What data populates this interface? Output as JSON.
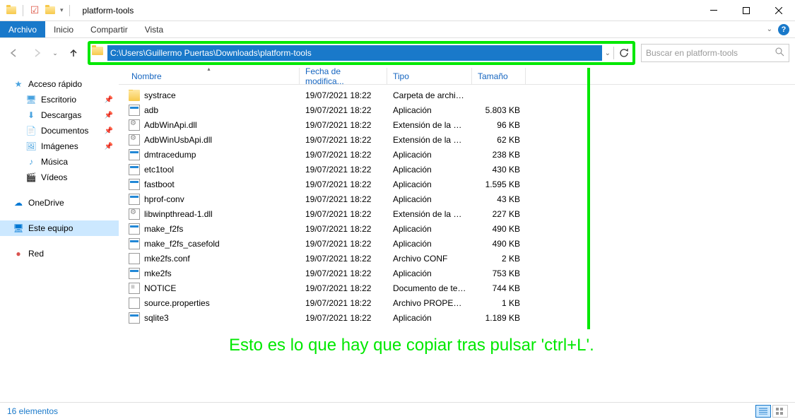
{
  "window": {
    "title": "platform-tools"
  },
  "ribbon": {
    "tabs": [
      "Archivo",
      "Inicio",
      "Compartir",
      "Vista"
    ],
    "active": 0
  },
  "nav": {
    "path": "C:\\Users\\Guillermo Puertas\\Downloads\\platform-tools",
    "search_placeholder": "Buscar en platform-tools"
  },
  "sidebar": {
    "quick": {
      "label": "Acceso rápido",
      "items": [
        {
          "label": "Escritorio",
          "pinned": true,
          "icon": "desktop"
        },
        {
          "label": "Descargas",
          "pinned": true,
          "icon": "downloads"
        },
        {
          "label": "Documentos",
          "pinned": true,
          "icon": "documents"
        },
        {
          "label": "Imágenes",
          "pinned": true,
          "icon": "images"
        },
        {
          "label": "Música",
          "pinned": false,
          "icon": "music"
        },
        {
          "label": "Vídeos",
          "pinned": false,
          "icon": "videos"
        }
      ]
    },
    "onedrive": {
      "label": "OneDrive"
    },
    "thispc": {
      "label": "Este equipo"
    },
    "network": {
      "label": "Red"
    }
  },
  "columns": {
    "name": "Nombre",
    "date": "Fecha de modifica...",
    "type": "Tipo",
    "size": "Tamaño"
  },
  "files": [
    {
      "name": "systrace",
      "date": "19/07/2021 18:22",
      "type": "Carpeta de archivos",
      "size": "",
      "icon": "folder"
    },
    {
      "name": "adb",
      "date": "19/07/2021 18:22",
      "type": "Aplicación",
      "size": "5.803 KB",
      "icon": "exe"
    },
    {
      "name": "AdbWinApi.dll",
      "date": "19/07/2021 18:22",
      "type": "Extensión de la apl...",
      "size": "96 KB",
      "icon": "dll"
    },
    {
      "name": "AdbWinUsbApi.dll",
      "date": "19/07/2021 18:22",
      "type": "Extensión de la apl...",
      "size": "62 KB",
      "icon": "dll"
    },
    {
      "name": "dmtracedump",
      "date": "19/07/2021 18:22",
      "type": "Aplicación",
      "size": "238 KB",
      "icon": "exe"
    },
    {
      "name": "etc1tool",
      "date": "19/07/2021 18:22",
      "type": "Aplicación",
      "size": "430 KB",
      "icon": "exe"
    },
    {
      "name": "fastboot",
      "date": "19/07/2021 18:22",
      "type": "Aplicación",
      "size": "1.595 KB",
      "icon": "exe"
    },
    {
      "name": "hprof-conv",
      "date": "19/07/2021 18:22",
      "type": "Aplicación",
      "size": "43 KB",
      "icon": "exe"
    },
    {
      "name": "libwinpthread-1.dll",
      "date": "19/07/2021 18:22",
      "type": "Extensión de la apl...",
      "size": "227 KB",
      "icon": "dll"
    },
    {
      "name": "make_f2fs",
      "date": "19/07/2021 18:22",
      "type": "Aplicación",
      "size": "490 KB",
      "icon": "exe"
    },
    {
      "name": "make_f2fs_casefold",
      "date": "19/07/2021 18:22",
      "type": "Aplicación",
      "size": "490 KB",
      "icon": "exe"
    },
    {
      "name": "mke2fs.conf",
      "date": "19/07/2021 18:22",
      "type": "Archivo CONF",
      "size": "2 KB",
      "icon": "blank"
    },
    {
      "name": "mke2fs",
      "date": "19/07/2021 18:22",
      "type": "Aplicación",
      "size": "753 KB",
      "icon": "exe"
    },
    {
      "name": "NOTICE",
      "date": "19/07/2021 18:22",
      "type": "Documento de tex...",
      "size": "744 KB",
      "icon": "txt"
    },
    {
      "name": "source.properties",
      "date": "19/07/2021 18:22",
      "type": "Archivo PROPERTI...",
      "size": "1 KB",
      "icon": "blank"
    },
    {
      "name": "sqlite3",
      "date": "19/07/2021 18:22",
      "type": "Aplicación",
      "size": "1.189 KB",
      "icon": "exe"
    }
  ],
  "status": {
    "count": "16 elementos"
  },
  "annotation": "Esto es lo que hay que copiar tras pulsar 'ctrl+L'."
}
